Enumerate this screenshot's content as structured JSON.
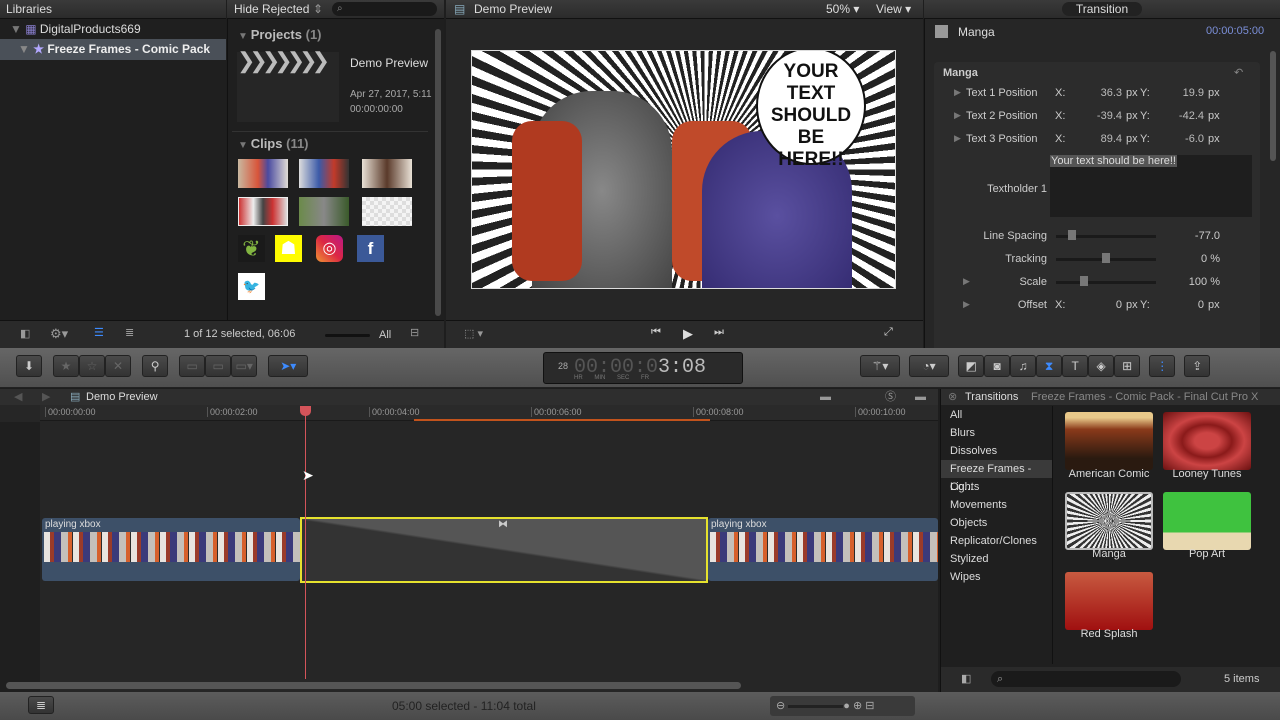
{
  "libraries": {
    "header": "Libraries",
    "library": "DigitalProducts669",
    "event": "Freeze Frames - Comic Pack"
  },
  "browser": {
    "filter": "Hide Rejected",
    "projects_label": "Projects",
    "projects_count": "(1)",
    "project": {
      "name": "Demo Preview",
      "date": "Apr 27, 2017, 5:11",
      "duration": "00:00:00:00"
    },
    "clips_label": "Clips",
    "clips_count": "(11)",
    "social_icons": [
      "envato-leaf-icon",
      "snapchat-icon",
      "instagram-icon",
      "facebook-icon",
      "twitter-icon"
    ],
    "status": "1 of 12 selected, 06:06",
    "zoom_all": "All"
  },
  "viewer": {
    "title": "Demo Preview",
    "zoom": "50%",
    "view": "View",
    "bubble_text": "YOUR TEXT SHOULD BE HERE!!"
  },
  "inspector": {
    "tab": "Transition",
    "name": "Manga",
    "duration": "00:00:05:00",
    "section": "Manga",
    "positions": [
      {
        "label": "Text 1 Position",
        "x": "36.3",
        "y": "19.9"
      },
      {
        "label": "Text 2 Position",
        "x": "-39.4",
        "y": "-42.4"
      },
      {
        "label": "Text 3 Position",
        "x": "89.4",
        "y": "-6.0"
      }
    ],
    "x_label": "X:",
    "y_label": "Y:",
    "unit": "px",
    "textholder_label": "Textholder 1",
    "textholder_value": "Your text should be here!!",
    "line_spacing": {
      "label": "Line Spacing",
      "value": "-77.0"
    },
    "tracking": {
      "label": "Tracking",
      "value": "0 %"
    },
    "scale": {
      "label": "Scale",
      "value": "100 %"
    },
    "offset": {
      "label": "Offset",
      "x": "0",
      "y": "0"
    }
  },
  "toolbar": {
    "timecode": "00:00:03:08",
    "timecode_visible": "3:08",
    "fps": "28",
    "tc_units": [
      "HR",
      "MIN",
      "SEC",
      "FR"
    ]
  },
  "timeline": {
    "title": "Demo Preview",
    "ruler": [
      "00:00:00:00",
      "00:00:02:00",
      "00:00:04:00",
      "00:00:06:00",
      "00:00:08:00",
      "00:00:10:00"
    ],
    "clip_left": "playing xbox",
    "clip_right": "playing xbox",
    "status": "05:00 selected - 11:04 total",
    "accent": "#e6e22e"
  },
  "transitions": {
    "title": "Transitions",
    "subtitle": "Freeze Frames - Comic Pack - Final Cut Pro X",
    "categories": [
      "All",
      "Blurs",
      "Dissolves",
      "Freeze Frames - Co...",
      "Lights",
      "Movements",
      "Objects",
      "Replicator/Clones",
      "Stylized",
      "Wipes"
    ],
    "items": [
      "American Comic",
      "Looney Tunes",
      "Manga",
      "Pop Art",
      "Red Splash"
    ],
    "count": "5 items"
  }
}
